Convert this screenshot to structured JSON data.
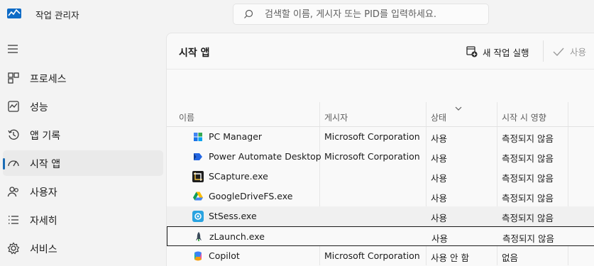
{
  "app": {
    "title": "작업 관리자"
  },
  "search": {
    "placeholder": "검색할 이름, 게시자 또는 PID를 입력하세요."
  },
  "sidebar": {
    "items": [
      {
        "label": "프로세스",
        "icon": "processes-icon"
      },
      {
        "label": "성능",
        "icon": "performance-icon"
      },
      {
        "label": "앱 기록",
        "icon": "app-history-icon"
      },
      {
        "label": "시작 앱",
        "icon": "startup-apps-icon",
        "active": true
      },
      {
        "label": "사용자",
        "icon": "users-icon"
      },
      {
        "label": "자세히",
        "icon": "details-icon"
      },
      {
        "label": "서비스",
        "icon": "services-icon"
      }
    ]
  },
  "main": {
    "title": "시작 앱",
    "toolbar": {
      "run_new_task": "새 작업 실행",
      "enable": "사용"
    }
  },
  "table": {
    "columns": [
      "이름",
      "게시자",
      "상태",
      "시작 시 영향"
    ],
    "rows": [
      {
        "name": "PC Manager",
        "publisher": "Microsoft Corporation",
        "status": "사용",
        "impact": "측정되지 않음",
        "icon": "pc-manager-icon"
      },
      {
        "name": "Power Automate Desktop",
        "publisher": "Microsoft Corporation",
        "status": "사용",
        "impact": "측정되지 않음",
        "icon": "power-automate-icon"
      },
      {
        "name": "SCapture.exe",
        "publisher": "",
        "status": "사용",
        "impact": "측정되지 않음",
        "icon": "scapture-icon"
      },
      {
        "name": "GoogleDriveFS.exe",
        "publisher": "",
        "status": "사용",
        "impact": "측정되지 않음",
        "icon": "google-drive-icon"
      },
      {
        "name": "StSess.exe",
        "publisher": "",
        "status": "사용",
        "impact": "측정되지 않음",
        "icon": "stsess-icon"
      },
      {
        "name": "zLaunch.exe",
        "publisher": "",
        "status": "사용",
        "impact": "측정되지 않음",
        "icon": "zlaunch-icon"
      },
      {
        "name": "Copilot",
        "publisher": "Microsoft Corporation",
        "status": "사용 안 함",
        "impact": "없음",
        "icon": "copilot-icon"
      }
    ]
  },
  "colors": {
    "accent": "#1a6cb5",
    "background": "#f3f3f3",
    "panel": "#f9f9f9"
  }
}
